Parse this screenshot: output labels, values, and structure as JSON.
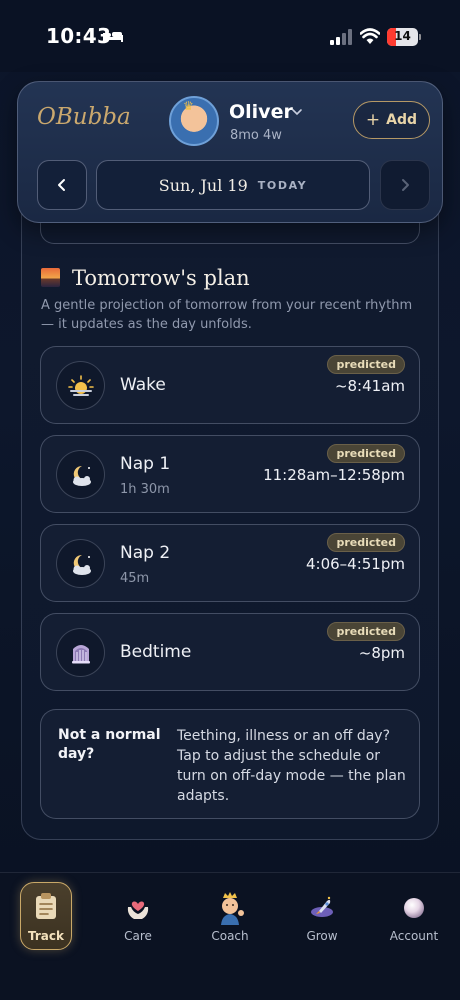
{
  "status_bar": {
    "time": "10:43",
    "battery": "14"
  },
  "header": {
    "logo": "OBubba",
    "child_name": "Oliver",
    "child_age": "8mo 4w",
    "add_label": "Add",
    "date": "Sun, Jul 19",
    "today_label": "TODAY"
  },
  "plan": {
    "title": "Tomorrow's plan",
    "description": "A gentle projection of tomorrow from your recent rhythm — it updates as the day unfolds.",
    "items": [
      {
        "name": "Wake",
        "duration": "",
        "badge": "predicted",
        "time": "~8:41am",
        "icon": "sunrise-icon"
      },
      {
        "name": "Nap 1",
        "duration": "1h 30m",
        "badge": "predicted",
        "time": "11:28am–12:58pm",
        "icon": "moon-cloud-icon"
      },
      {
        "name": "Nap 2",
        "duration": "45m",
        "badge": "predicted",
        "time": "4:06–4:51pm",
        "icon": "moon-cloud-icon"
      },
      {
        "name": "Bedtime",
        "duration": "",
        "badge": "predicted",
        "time": "~8pm",
        "icon": "crib-icon"
      }
    ],
    "offday": {
      "title": "Not a normal day?",
      "text": "Teething, illness or an off day? Tap to adjust the schedule or turn on off-day mode — the plan adapts."
    }
  },
  "nav": {
    "items": [
      {
        "label": "Track",
        "icon": "clipboard-icon",
        "active": true
      },
      {
        "label": "Care",
        "icon": "hands-heart-icon"
      },
      {
        "label": "Coach",
        "icon": "baby-coach-icon"
      },
      {
        "label": "Grow",
        "icon": "rocket-icon"
      },
      {
        "label": "Account",
        "icon": "account-orb-icon"
      }
    ]
  },
  "colors": {
    "accent_gold": "#c9a868",
    "badge_bg": "#4a4536",
    "background": "#0d172c"
  }
}
